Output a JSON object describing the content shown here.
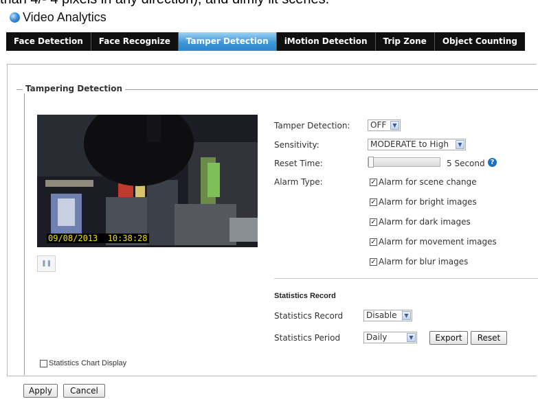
{
  "top_cut_text": "than 4/- 4 pixels in any direction), and dimly lit scenes.",
  "app": {
    "title": "Video Analytics",
    "icon": "globe-icon"
  },
  "tabs": [
    {
      "label": "Face Detection",
      "active": false
    },
    {
      "label": "Face Recognize",
      "active": false
    },
    {
      "label": "Tamper Detection",
      "active": true
    },
    {
      "label": "iMotion Detection",
      "active": false
    },
    {
      "label": "Trip Zone",
      "active": false
    },
    {
      "label": "Object Counting",
      "active": false
    }
  ],
  "section": {
    "legend": "Tampering Detection",
    "video": {
      "timestamp": "09/08/2013  10:38:28",
      "pause_icon": "pause-icon"
    },
    "settings": {
      "tamper_detection_label": "Tamper Detection:",
      "tamper_detection_value": "OFF",
      "sensitivity_label": "Sensitivity:",
      "sensitivity_value": "MODERATE to High",
      "reset_time_label": "Reset Time:",
      "reset_time_value": "5 Second",
      "reset_time_fraction": 0.0,
      "alarm_type_label": "Alarm Type:",
      "alarms": [
        {
          "label": "Alarm for scene change",
          "checked": true
        },
        {
          "label": "Alarm for bright images",
          "checked": true
        },
        {
          "label": "Alarm for dark images",
          "checked": true
        },
        {
          "label": "Alarm for movement images",
          "checked": true
        },
        {
          "label": "Alarm for blur images",
          "checked": true
        }
      ]
    },
    "statistics": {
      "heading": "Statistics Record",
      "record_label": "Statistics Record",
      "record_value": "Disable",
      "period_label": "Statistics Period",
      "period_value": "Daily",
      "export_label": "Export",
      "reset_label": "Reset"
    },
    "chart_display": {
      "label": "Statistics Chart Display",
      "checked": false
    }
  },
  "footer": {
    "apply_label": "Apply",
    "cancel_label": "Cancel"
  },
  "colors": {
    "tab_bar": "#101010",
    "tab_active": "#3f97d8",
    "help_icon": "#1d6fc4",
    "timestamp_text": "#f0e000"
  }
}
